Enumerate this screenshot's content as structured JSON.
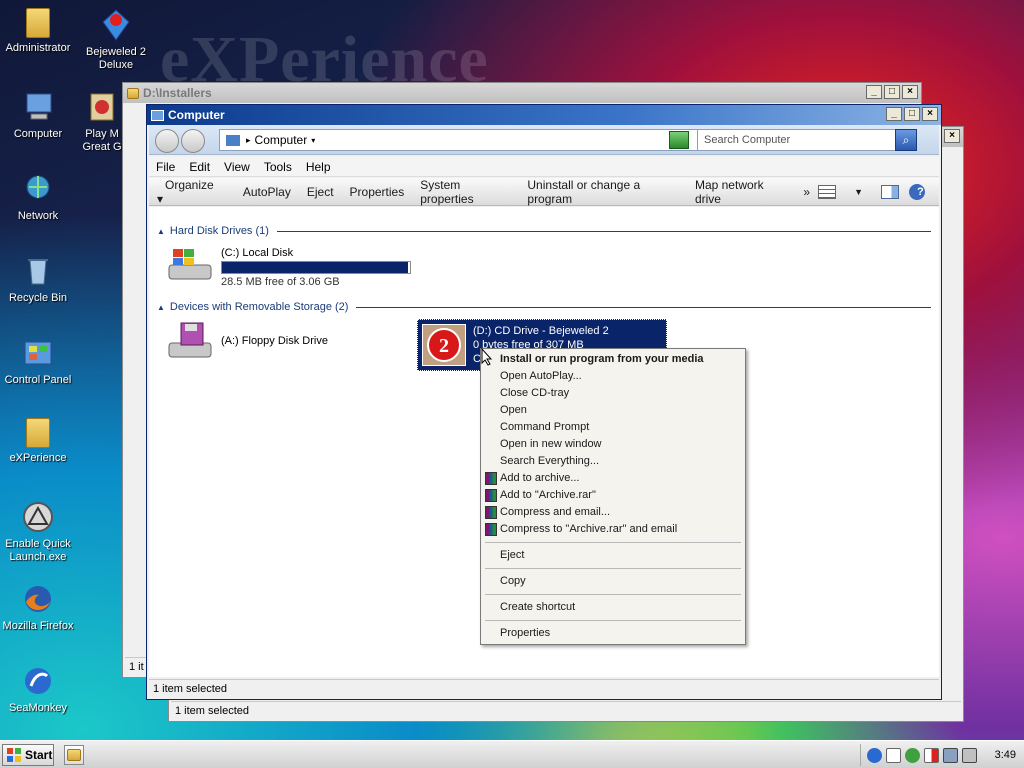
{
  "desktop": {
    "watermark": "eXPerience",
    "icons": [
      {
        "label": "Administrator",
        "icon": "folder-user-icon"
      },
      {
        "label": "Bejeweled 2 Deluxe",
        "icon": "bejeweled-icon"
      },
      {
        "label": "Computer",
        "icon": "computer-icon"
      },
      {
        "label": "Play M Great G",
        "icon": "game-icon"
      },
      {
        "label": "Network",
        "icon": "network-icon"
      },
      {
        "label": "Recycle Bin",
        "icon": "recycle-bin-icon"
      },
      {
        "label": "Control Panel",
        "icon": "control-panel-icon"
      },
      {
        "label": "eXPerience",
        "icon": "folder-icon"
      },
      {
        "label": "Enable Quick Launch.exe",
        "icon": "quick-launch-icon"
      },
      {
        "label": "Mozilla Firefox",
        "icon": "firefox-icon"
      },
      {
        "label": "SeaMonkey",
        "icon": "seamonkey-icon"
      }
    ]
  },
  "back_window_1": {
    "title": "D:\\Installers",
    "status": "1 it"
  },
  "back_window_2": {
    "status": "1 item selected"
  },
  "explorer": {
    "title": "Computer",
    "address": "Computer",
    "search_placeholder": "Search Computer",
    "menus": [
      "File",
      "Edit",
      "View",
      "Tools",
      "Help"
    ],
    "commands": [
      "Organize",
      "AutoPlay",
      "Eject",
      "Properties",
      "System properties",
      "Uninstall or change a program",
      "Map network drive",
      "»"
    ],
    "groups": [
      {
        "label": "Hard Disk Drives (1)"
      },
      {
        "label": "Devices with Removable Storage (2)"
      }
    ],
    "local_disk": {
      "name": "(C:) Local Disk",
      "free": "28.5 MB free of 3.06 GB",
      "used_fraction": 0.99
    },
    "floppy": {
      "name": "(A:) Floppy Disk Drive"
    },
    "cd_drive": {
      "name": "(D:) CD Drive - Bejeweled 2",
      "free": "0 bytes free of 307 MB",
      "fs": "C"
    },
    "status": "1 item selected"
  },
  "context_menu": {
    "items": [
      {
        "label": "Install or run program from your media",
        "bold": true
      },
      {
        "label": "Open AutoPlay..."
      },
      {
        "label": "Close CD-tray"
      },
      {
        "label": "Open"
      },
      {
        "label": "Command Prompt"
      },
      {
        "label": "Open in new window"
      },
      {
        "label": "Search Everything..."
      },
      {
        "label": "Add to archive...",
        "rar": true
      },
      {
        "label": "Add to \"Archive.rar\"",
        "rar": true
      },
      {
        "label": "Compress and email...",
        "rar": true
      },
      {
        "label": "Compress to \"Archive.rar\" and email",
        "rar": true
      },
      {
        "label": "Eject"
      },
      {
        "label": "Copy"
      },
      {
        "label": "Create shortcut"
      },
      {
        "label": "Properties"
      }
    ]
  },
  "taskbar": {
    "start_label": "Start",
    "clock": "3:49"
  },
  "colors": {
    "title_active": "#0c3a8c",
    "selection": "#0a246a",
    "progress": "#0a246a"
  }
}
